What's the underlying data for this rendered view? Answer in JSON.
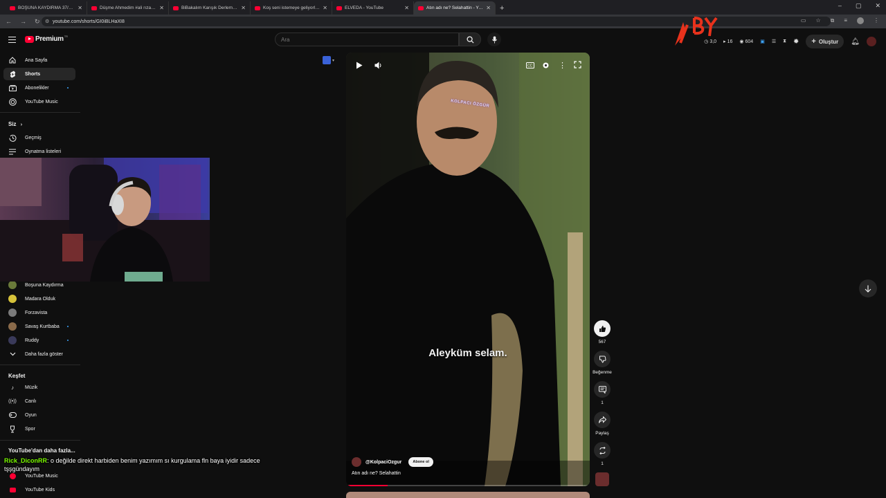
{
  "browser": {
    "tabs": [
      {
        "title": "BOŞUNA KAYDIRMA 37/#BK37"
      },
      {
        "title": "Düşme Ahmedim #ali rıza #nen"
      },
      {
        "title": "BiBakalım Karışık Derleme #83"
      },
      {
        "title": "Koş seni istemeye geliyorlarmış"
      },
      {
        "title": "ELVEDA - YouTube"
      },
      {
        "title": "Atın adı ne? Selahattin - YouTub"
      }
    ],
    "active_tab": 5,
    "url": "youtube.com/shorts/GI0iBLHaXI8",
    "new_tab": "+",
    "window_controls": [
      "–",
      "▢",
      "✕"
    ]
  },
  "header": {
    "brand": "Premium",
    "brand_superscript": "TR",
    "search_placeholder": "Ara",
    "create_label": "Oluştur",
    "stats": [
      {
        "icon": "gauge-icon",
        "value": "3,0"
      },
      {
        "icon": "video-icon",
        "value": "16"
      },
      {
        "icon": "eye-icon",
        "value": "604"
      }
    ]
  },
  "sidebar": {
    "main": [
      {
        "label": "Ana Sayfa",
        "icon": "home-icon"
      },
      {
        "label": "Shorts",
        "icon": "shorts-icon",
        "active": true
      },
      {
        "label": "Abonelikler",
        "icon": "subscriptions-icon"
      },
      {
        "label": "YouTube Music",
        "icon": "music-circle-icon"
      }
    ],
    "you_section": "Siz",
    "you_items": [
      {
        "label": "Geçmiş",
        "icon": "history-icon"
      },
      {
        "label": "Oynatma listeleri",
        "icon": "playlist-icon"
      }
    ],
    "channels": [
      {
        "label": "Boşuna Kaydırma",
        "color": "#6a7a3a"
      },
      {
        "label": "Madara Olduk",
        "color": "#d6c23a"
      },
      {
        "label": "Forzavista",
        "color": "#7a7a7a"
      },
      {
        "label": "Savaş Kurtbaba",
        "color": "#8a6a4a"
      },
      {
        "label": "Ruddy",
        "color": "#3a3a5a"
      }
    ],
    "show_more": "Daha fazla göster",
    "explore_section": "Keşfet",
    "explore_items": [
      {
        "label": "Müzik",
        "icon": "music-note-icon"
      },
      {
        "label": "Canlı",
        "icon": "live-icon"
      },
      {
        "label": "Oyun",
        "icon": "gamepad-icon"
      },
      {
        "label": "Spor",
        "icon": "trophy-icon"
      }
    ],
    "more_section": "YouTube'dan daha fazla...",
    "more_items": [
      {
        "label": "YouTube Music",
        "color": "#ff0033"
      },
      {
        "label": "YouTube Kids",
        "color": "#ff0033"
      }
    ]
  },
  "short": {
    "subtitle": "Aleyküm selam.",
    "watermark": "KOLPACI ÖZGÜR",
    "channel": "@KolpaciOzgur",
    "subscribe_label": "Abone ol",
    "title": "Atın adı ne? Selahattin",
    "progress": 0.17
  },
  "actions": {
    "like_count": "567",
    "dislike_label": "Beğenme",
    "comment_count": "1",
    "share_label": "Paylaş",
    "remix_count": "1"
  },
  "chat": {
    "user": "Rick_DiconRR",
    "message": ": o değilde direkt harbiden benim yazımım sı kurgulama fln baya iyidir sadece",
    "message_line2": "tşşgündayım"
  },
  "colors": {
    "brand_red": "#ff0033",
    "bg": "#0f0f0f",
    "chat_user": "#7cfc00"
  }
}
